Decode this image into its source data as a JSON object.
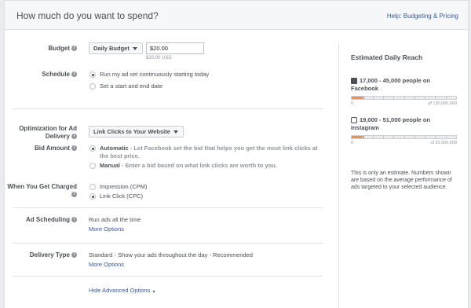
{
  "header": {
    "title": "How much do you want to spend?",
    "help_link": "Help: Budgeting & Pricing"
  },
  "budget": {
    "label": "Budget",
    "type_value": "Daily Budget",
    "amount_value": "$20.00",
    "currency_note": "$20.00 USD"
  },
  "schedule": {
    "label": "Schedule",
    "options": [
      {
        "text": "Run my ad set continuously starting today",
        "selected": true
      },
      {
        "text": "Set a start and end date",
        "selected": false
      }
    ]
  },
  "optimization": {
    "label": "Optimization for Ad Delivery",
    "value": "Link Clicks to Your Website"
  },
  "bid_amount": {
    "label": "Bid Amount",
    "options": [
      {
        "name": "Automatic",
        "desc": " - Let Facebook set the bid that helps you get the most link clicks at the best price.",
        "selected": true
      },
      {
        "name": "Manual",
        "desc": " - Enter a bid based on what link clicks are worth to you.",
        "selected": false
      }
    ]
  },
  "charged": {
    "label": "When You Get Charged",
    "options": [
      {
        "text": "Impression (CPM)",
        "selected": false
      },
      {
        "text": "Link Click (CPC)",
        "selected": true
      }
    ]
  },
  "ad_scheduling": {
    "label": "Ad Scheduling",
    "value": "Run ads all the time",
    "more": "More Options"
  },
  "delivery_type": {
    "label": "Delivery Type",
    "value_name": "Standard",
    "value_desc": " - Show your ads throughout the day - Recommended",
    "more": "More Options"
  },
  "hide_advanced": "Hide Advanced Options",
  "reach": {
    "title": "Estimated Daily Reach",
    "facebook": {
      "text": "17,000 - 45,000 people on Facebook",
      "min": "0",
      "max": "of 130,000,000",
      "fill_fraction": 0.12
    },
    "instagram": {
      "text": "19,000 - 51,000 people on Instagram",
      "min": "0",
      "max": "of 31,000,000",
      "fill_fraction": 0.12
    },
    "note": "This is only an estimate. Numbers shown are based on the average performance of ads targeted to your selected audience."
  },
  "colors": {
    "link": "#365899",
    "accent": "#f7923b"
  }
}
